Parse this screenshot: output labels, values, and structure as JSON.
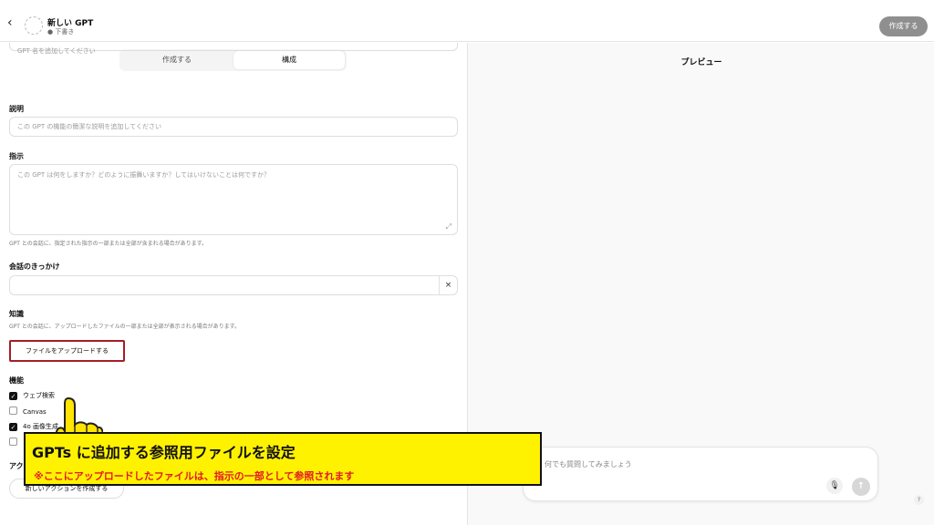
{
  "header": {
    "title": "新しい GPT",
    "status": "● 下書き",
    "create_label": "作成する"
  },
  "tabs": [
    {
      "label": "作成する",
      "active": false
    },
    {
      "label": "構成",
      "active": true
    }
  ],
  "form": {
    "name_placeholder": "GPT 名を追加してください",
    "description_label": "説明",
    "description_placeholder": "この GPT の機能の簡潔な説明を追加してください",
    "instructions_label": "指示",
    "instructions_placeholder": "この GPT は何をしますか？どのように振舞いますか？してはいけないことは何ですか？",
    "instructions_help": "GPT との会話に、指定された指示の一部または全部が含まれる場合があります。",
    "starters_label": "会話のきっかけ",
    "knowledge_label": "知識",
    "knowledge_help": "GPT との会話に、アップロードしたファイルの一部または全部が表示される場合があります。",
    "upload_label": "ファイルをアップロードする",
    "capabilities_label": "機能",
    "capabilities": [
      {
        "label": "ウェブ検索",
        "checked": true
      },
      {
        "label": "Canvas",
        "checked": false
      },
      {
        "label": "4o 画像生成",
        "checked": true
      }
    ],
    "actions_label": "アクション",
    "new_action_label": "新しいアクションを作成する"
  },
  "callout": {
    "title": "GPTs に追加する参照用ファイルを設定",
    "note": "※ここにアップロードしたファイルは、指示の一部として参照されます"
  },
  "preview": {
    "title": "プレビュー",
    "input_placeholder": "何でも質問してみましょう",
    "help_label": "?"
  },
  "colors": {
    "accent_red": "#a51d24",
    "callout_yellow": "#fff200",
    "callout_note_red": "#e21b23"
  }
}
